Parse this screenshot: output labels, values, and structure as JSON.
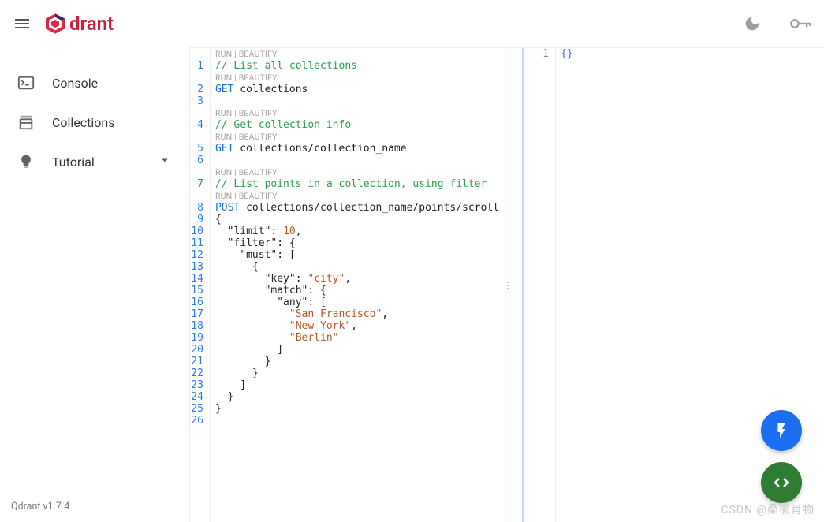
{
  "header": {
    "logo_text": "drant"
  },
  "sidebar": {
    "items": [
      {
        "label": "Console"
      },
      {
        "label": "Collections"
      },
      {
        "label": "Tutorial"
      }
    ],
    "version": "Qdrant v1.7.4"
  },
  "editor": {
    "hints": {
      "run": "RUN",
      "beautify": "BEAUTIFY"
    },
    "lines": [
      {
        "n": 1,
        "hint": true,
        "type": "comment",
        "text": "// List all collections",
        "hl": true
      },
      {
        "n": 2,
        "hint": true,
        "method": "GET",
        "path": "collections"
      },
      {
        "n": 3,
        "blank": true
      },
      {
        "n": 4,
        "hint": true,
        "type": "comment",
        "text": "// Get collection info"
      },
      {
        "n": 5,
        "hint": true,
        "method": "GET",
        "path": "collections/collection_name"
      },
      {
        "n": 6,
        "blank": true
      },
      {
        "n": 7,
        "hint": true,
        "type": "comment",
        "text": "// List points in a collection, using filter"
      },
      {
        "n": 8,
        "hint": true,
        "method": "POST",
        "path": "collections/collection_name/points/scroll"
      },
      {
        "n": 9,
        "json": "{"
      },
      {
        "n": 10,
        "json": "  \"limit\": 10,"
      },
      {
        "n": 11,
        "json": "  \"filter\": {"
      },
      {
        "n": 12,
        "json": "    \"must\": ["
      },
      {
        "n": 13,
        "json": "      {"
      },
      {
        "n": 14,
        "json": "        \"key\": \"city\","
      },
      {
        "n": 15,
        "json": "        \"match\": {"
      },
      {
        "n": 16,
        "json": "          \"any\": ["
      },
      {
        "n": 17,
        "json": "            \"San Francisco\","
      },
      {
        "n": 18,
        "json": "            \"New York\","
      },
      {
        "n": 19,
        "json": "            \"Berlin\""
      },
      {
        "n": 20,
        "json": "          ]"
      },
      {
        "n": 21,
        "json": "        }"
      },
      {
        "n": 22,
        "json": "      }"
      },
      {
        "n": 23,
        "json": "    ]"
      },
      {
        "n": 24,
        "json": "  }"
      },
      {
        "n": 25,
        "json": "}"
      },
      {
        "n": 26,
        "blank": true
      }
    ]
  },
  "result": {
    "lines": [
      {
        "n": 1,
        "text": "{}"
      }
    ]
  },
  "watermark": "CSDN @桑榆肖物"
}
